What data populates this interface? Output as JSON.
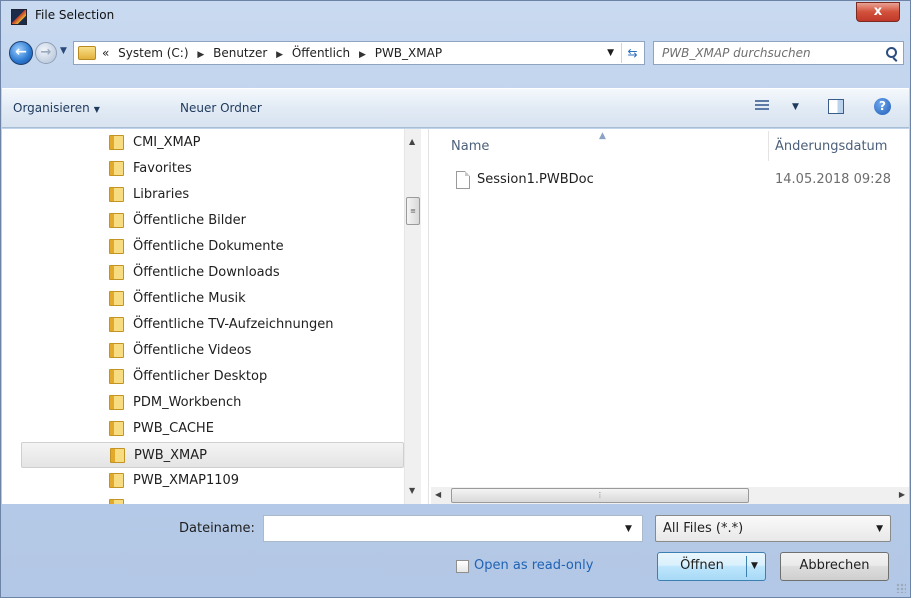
{
  "window": {
    "title": "File Selection",
    "close_label": "x"
  },
  "address": {
    "crumb_prefix": "«",
    "crumbs": [
      "System (C:)",
      "Benutzer",
      "Öffentlich",
      "PWB_XMAP"
    ]
  },
  "search": {
    "placeholder": "PWB_XMAP durchsuchen"
  },
  "toolbar": {
    "organise_label": "Organisieren",
    "new_folder_label": "Neuer Ordner"
  },
  "tree": {
    "items": [
      {
        "label": "CMI_XMAP"
      },
      {
        "label": "Favorites"
      },
      {
        "label": "Libraries"
      },
      {
        "label": "Öffentliche Bilder"
      },
      {
        "label": "Öffentliche Dokumente"
      },
      {
        "label": "Öffentliche Downloads"
      },
      {
        "label": "Öffentliche Musik"
      },
      {
        "label": "Öffentliche TV-Aufzeichnungen"
      },
      {
        "label": "Öffentliche Videos"
      },
      {
        "label": "Öffentlicher Desktop"
      },
      {
        "label": "PDM_Workbench"
      },
      {
        "label": "PWB_CACHE"
      },
      {
        "label": "PWB_XMAP"
      },
      {
        "label": "PWB_XMAP1109"
      }
    ],
    "selected": "PWB_XMAP"
  },
  "files": {
    "columns": {
      "name": "Name",
      "date": "Änderungsdatum"
    },
    "rows": [
      {
        "name": "Session1.PWBDoc",
        "date": "14.05.2018 09:28"
      }
    ]
  },
  "footer": {
    "filename_label": "Dateiname:",
    "filename_value": "",
    "filter_value": "All Files (*.*)",
    "readonly_label": "Open as read-only",
    "open_label": "Öffnen",
    "cancel_label": "Abbrechen"
  }
}
